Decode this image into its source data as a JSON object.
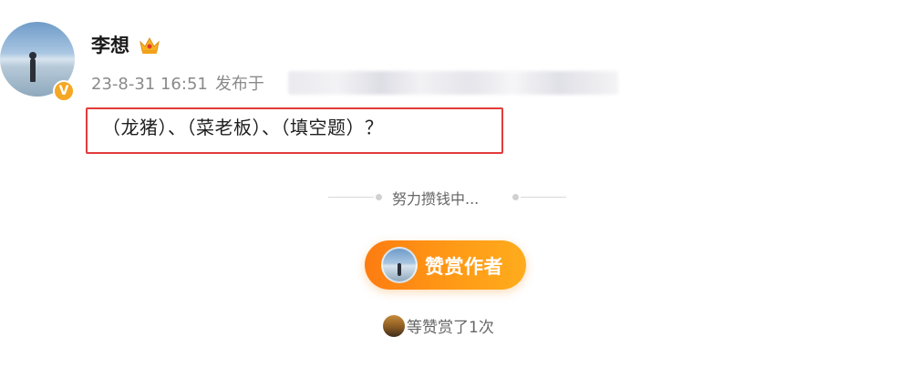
{
  "user": {
    "name": "李想",
    "verified_mark": "V",
    "crown_icon": "crown-icon"
  },
  "post": {
    "timestamp": "23-8-31 16:51",
    "source_prefix": "发布于",
    "text": "（龙猪）、（菜老板）、（填空题）？",
    "highlight_color": "#e23b3b"
  },
  "reward": {
    "status_text": "努力攒钱中...",
    "button_label": "赞赏作者",
    "count_text": "等赞赏了1次",
    "accent_color": "#fd7c11"
  }
}
